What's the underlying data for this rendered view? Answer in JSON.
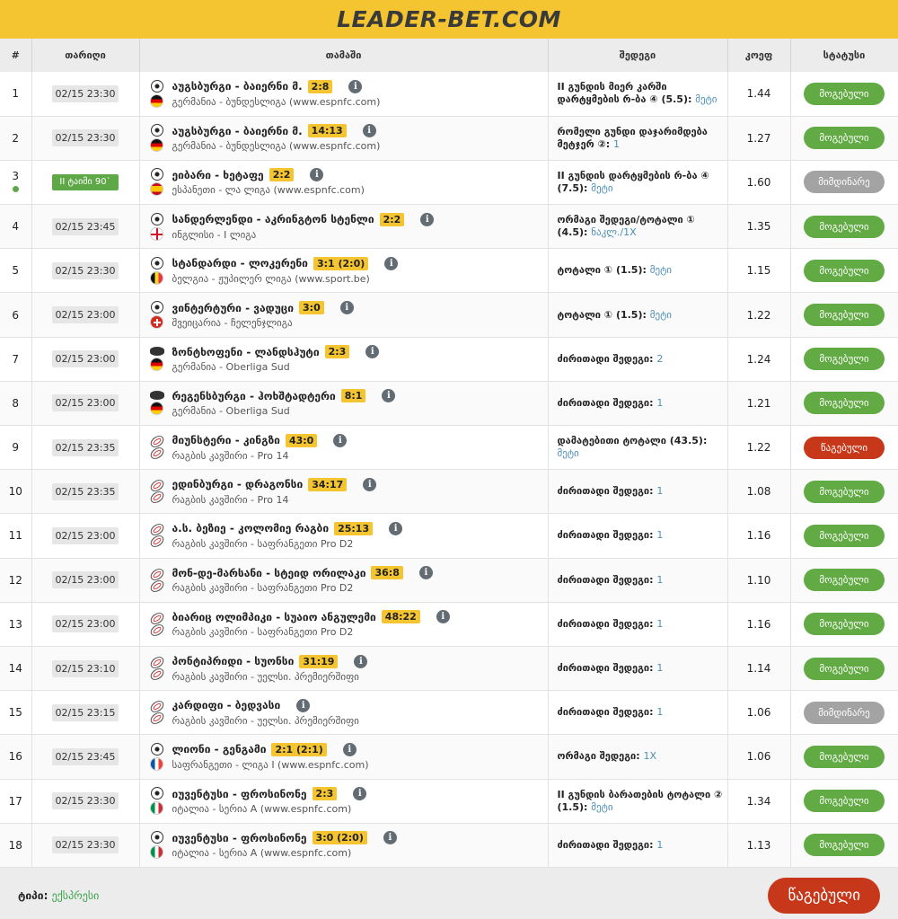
{
  "header": {
    "logo_text": "LEADER-BET.COM"
  },
  "table": {
    "columns": [
      "#",
      "თარიღი",
      "თამაში",
      "შედეგი",
      "კოეფ",
      "სტატუსი"
    ],
    "rows": [
      {
        "num": "1",
        "date": "02/15 23:30",
        "sport": "soccer-icon",
        "flag": "de",
        "match": "აუგსბურგი - ბაიერნი მ.",
        "score": "2:8",
        "league": "გერმანია - ბუნდესლიგა (www.espnfc.com)",
        "result": "II გუნდის მიერ კარში დარტყმების რ-ბა ④ (5.5):",
        "pick": "მეტი",
        "odds": "1.44",
        "status": "მოგებული",
        "status_type": "won"
      },
      {
        "num": "2",
        "date": "02/15 23:30",
        "sport": "soccer-icon",
        "flag": "de",
        "match": "აუგსბურგი - ბაიერნი მ.",
        "score": "14:13",
        "league": "გერმანია - ბუნდესლიგა (www.espnfc.com)",
        "result": "რომელი გუნდი დაჯარიმდება მეტჯერ ②:",
        "pick": "1",
        "odds": "1.27",
        "status": "მოგებული",
        "status_type": "won"
      },
      {
        "num": "3",
        "live": true,
        "date": "II ტაიმი 90`",
        "sport": "soccer-icon",
        "flag": "es",
        "match": "ეიბარი - ხეტაფე",
        "score": "2:2",
        "league": "ესპანეთი - ლა ლიგა (www.espnfc.com)",
        "result": "II გუნდის დარტყმების რ-ბა ④ (7.5):",
        "pick": "მეტი",
        "odds": "1.60",
        "status": "მიმდინარე",
        "status_type": "live"
      },
      {
        "num": "4",
        "date": "02/15 23:45",
        "sport": "soccer-icon",
        "flag": "en",
        "match": "სანდერლენდი - აკრინგტონ სტენლი",
        "score": "2:2",
        "league": "ინგლისი - I ლიგა",
        "result": "ორმაგი შედეგი/ტოტალი ① (4.5):",
        "pick": "ნაკლ./1X",
        "odds": "1.35",
        "status": "მოგებული",
        "status_type": "won"
      },
      {
        "num": "5",
        "date": "02/15 23:30",
        "sport": "soccer-icon",
        "flag": "be",
        "match": "სტანდარდი - ლოკერენი",
        "score": "3:1 (2:0)",
        "league": "ბელგია - ჟუპილერ ლიგა (www.sport.be)",
        "result": "ტოტალი ① (1.5):",
        "pick": "მეტი",
        "odds": "1.15",
        "status": "მოგებული",
        "status_type": "won"
      },
      {
        "num": "6",
        "date": "02/15 23:00",
        "sport": "soccer-icon",
        "flag": "ch",
        "match": "ვინტერტური - ვადუცი",
        "score": "3:0",
        "league": "შვეიცარია - ჩელენჯლიგა",
        "result": "ტოტალი ① (1.5):",
        "pick": "მეტი",
        "odds": "1.22",
        "status": "მოგებული",
        "status_type": "won"
      },
      {
        "num": "7",
        "date": "02/15 23:00",
        "sport": "hockey-icon",
        "flag": "de",
        "match": "ზონტხოფენი - ლანდსჰუტი",
        "score": "2:3",
        "league": "გერმანია - Oberliga Sud",
        "result": "ძირითადი შედეგი:",
        "pick": "2",
        "odds": "1.24",
        "status": "მოგებული",
        "status_type": "won"
      },
      {
        "num": "8",
        "date": "02/15 23:00",
        "sport": "hockey-icon",
        "flag": "de",
        "match": "რეგენსბურგი - ჰოხშტადტერი",
        "score": "8:1",
        "league": "გერმანია - Oberliga Sud",
        "result": "ძირითადი შედეგი:",
        "pick": "1",
        "odds": "1.21",
        "status": "მოგებული",
        "status_type": "won"
      },
      {
        "num": "9",
        "date": "02/15 23:35",
        "sport": "rugby-icon",
        "flag": "rugby",
        "match": "მიუნსტერი - კინგზი",
        "score": "43:0",
        "league": "რაგბის კავშირი - Pro 14",
        "result": "დამატებითი ტოტალი (43.5):",
        "pick": "მეტი",
        "odds": "1.22",
        "status": "წაგებული",
        "status_type": "lost"
      },
      {
        "num": "10",
        "date": "02/15 23:35",
        "sport": "rugby-icon",
        "flag": "rugby",
        "match": "ედინბურგი - დრაგონსი",
        "score": "34:17",
        "league": "რაგბის კავშირი - Pro 14",
        "result": "ძირითადი შედეგი:",
        "pick": "1",
        "odds": "1.08",
        "status": "მოგებული",
        "status_type": "won"
      },
      {
        "num": "11",
        "date": "02/15 23:00",
        "sport": "rugby-icon",
        "flag": "rugby",
        "match": "ა.ს. ბეზიე - კოლომიე რაგბი",
        "score": "25:13",
        "league": "რაგბის კავშირი - საფრანგეთი Pro D2",
        "result": "ძირითადი შედეგი:",
        "pick": "1",
        "odds": "1.16",
        "status": "მოგებული",
        "status_type": "won"
      },
      {
        "num": "12",
        "date": "02/15 23:00",
        "sport": "rugby-icon",
        "flag": "rugby",
        "match": "მონ-დე-მარსანი - სტეიდ ორილაკი",
        "score": "36:8",
        "league": "რაგბის კავშირი - საფრანგეთი Pro D2",
        "result": "ძირითადი შედეგი:",
        "pick": "1",
        "odds": "1.10",
        "status": "მოგებული",
        "status_type": "won"
      },
      {
        "num": "13",
        "date": "02/15 23:00",
        "sport": "rugby-icon",
        "flag": "rugby",
        "match": "ბიარიც ოლიმპიკი - სუაიო ანგულემი",
        "score": "48:22",
        "league": "რაგბის კავშირი - საფრანგეთი Pro D2",
        "result": "ძირითადი შედეგი:",
        "pick": "1",
        "odds": "1.16",
        "status": "მოგებული",
        "status_type": "won"
      },
      {
        "num": "14",
        "date": "02/15 23:10",
        "sport": "rugby-icon",
        "flag": "rugby",
        "match": "პონტიპრიდი - სუონსი",
        "score": "31:19",
        "league": "რაგბის კავშირი - უელსი. პრემიერშიფი",
        "result": "ძირითადი შედეგი:",
        "pick": "1",
        "odds": "1.14",
        "status": "მოგებული",
        "status_type": "won"
      },
      {
        "num": "15",
        "date": "02/15 23:15",
        "sport": "rugby-icon",
        "flag": "rugby",
        "match": "კარდიფი - ბედვასი",
        "score": "",
        "league": "რაგბის კავშირი - უელსი. პრემიერშიფი",
        "result": "ძირითადი შედეგი:",
        "pick": "1",
        "odds": "1.06",
        "status": "მიმდინარე",
        "status_type": "live"
      },
      {
        "num": "16",
        "date": "02/15 23:45",
        "sport": "soccer-icon",
        "flag": "fr",
        "match": "ლიონი - გენგამი",
        "score": "2:1 (2:1)",
        "league": "საფრანგეთი - ლიგა I (www.espnfc.com)",
        "result": "ორმაგი შედეგი:",
        "pick": "1X",
        "odds": "1.06",
        "status": "მოგებული",
        "status_type": "won"
      },
      {
        "num": "17",
        "date": "02/15 23:30",
        "sport": "soccer-icon",
        "flag": "it",
        "match": "იუვენტუსი - ფროსინონე",
        "score": "2:3",
        "league": "იტალია - სერია A (www.espnfc.com)",
        "result": "II გუნდის ბარათების ტოტალი ② (1.5):",
        "pick": "მეტი",
        "odds": "1.34",
        "status": "მოგებული",
        "status_type": "won"
      },
      {
        "num": "18",
        "date": "02/15 23:30",
        "sport": "soccer-icon",
        "flag": "it",
        "match": "იუვენტუსი - ფროსინონე",
        "score": "3:0 (2:0)",
        "league": "იტალია - სერია A (www.espnfc.com)",
        "result": "ძირითადი შედეგი:",
        "pick": "1",
        "odds": "1.13",
        "status": "მოგებული",
        "status_type": "won"
      }
    ]
  },
  "footer": {
    "type_label": "ტიპი:",
    "type_value": "ექსპრესი",
    "final_status": "წაგებული"
  },
  "colors": {
    "brand": "#f5c531",
    "won": "#62ab44",
    "lost": "#c7381a",
    "live": "#a3a3a3"
  }
}
